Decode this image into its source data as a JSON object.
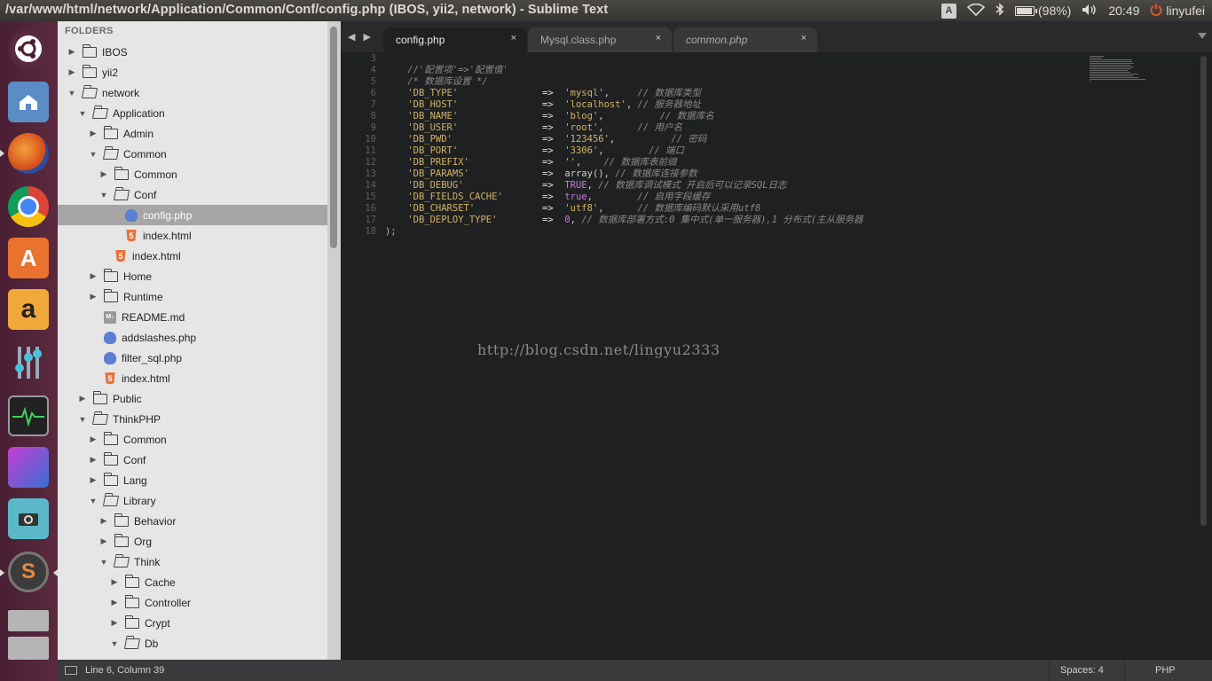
{
  "window": {
    "title": "/var/www/html/network/Application/Common/Conf/config.php (IBOS, yii2, network) - Sublime Text"
  },
  "top_panel": {
    "keyboard_indicator": "A",
    "battery_text": "(98%)",
    "battery_level": 0.98,
    "time": "20:49",
    "user": "linyufei"
  },
  "launcher": {
    "items": [
      "ubuntu-dash",
      "files",
      "firefox",
      "chrome",
      "software-center",
      "amazon",
      "mixer",
      "system-monitor",
      "workspaces",
      "screenshot",
      "sublime-text",
      "drives"
    ]
  },
  "sidebar": {
    "header": "FOLDERS",
    "rows": [
      {
        "label": "IBOS",
        "type": "folder",
        "open": false
      },
      {
        "label": "yii2",
        "type": "folder",
        "open": false
      },
      {
        "label": "network",
        "type": "folder",
        "open": true
      },
      {
        "label": "Application",
        "type": "folder",
        "open": true
      },
      {
        "label": "Admin",
        "type": "folder",
        "open": false
      },
      {
        "label": "Common",
        "type": "folder",
        "open": true
      },
      {
        "label": "Common",
        "type": "folder",
        "open": false
      },
      {
        "label": "Conf",
        "type": "folder",
        "open": true
      },
      {
        "label": "config.php",
        "type": "php",
        "selected": true
      },
      {
        "label": "index.html",
        "type": "html"
      },
      {
        "label": "index.html",
        "type": "html"
      },
      {
        "label": "Home",
        "type": "folder",
        "open": false
      },
      {
        "label": "Runtime",
        "type": "folder",
        "open": false
      },
      {
        "label": "README.md",
        "type": "md"
      },
      {
        "label": "addslashes.php",
        "type": "php"
      },
      {
        "label": "filter_sql.php",
        "type": "php"
      },
      {
        "label": "index.html",
        "type": "html"
      },
      {
        "label": "Public",
        "type": "folder",
        "open": false
      },
      {
        "label": "ThinkPHP",
        "type": "folder",
        "open": true
      },
      {
        "label": "Common",
        "type": "folder",
        "open": false
      },
      {
        "label": "Conf",
        "type": "folder",
        "open": false
      },
      {
        "label": "Lang",
        "type": "folder",
        "open": false
      },
      {
        "label": "Library",
        "type": "folder",
        "open": true
      },
      {
        "label": "Behavior",
        "type": "folder",
        "open": false
      },
      {
        "label": "Org",
        "type": "folder",
        "open": false
      },
      {
        "label": "Think",
        "type": "folder",
        "open": true
      },
      {
        "label": "Cache",
        "type": "folder",
        "open": false
      },
      {
        "label": "Controller",
        "type": "folder",
        "open": false
      },
      {
        "label": "Crypt",
        "type": "folder",
        "open": false
      },
      {
        "label": "Db",
        "type": "folder",
        "open": true
      }
    ]
  },
  "tabs": [
    {
      "label": "config.php",
      "close": "×",
      "active": true,
      "italic": false
    },
    {
      "label": "Mysql.class.php",
      "close": "×",
      "active": false,
      "italic": false
    },
    {
      "label": "common.php",
      "close": "×",
      "active": false,
      "italic": true
    }
  ],
  "editor": {
    "lines": [
      {
        "n": "3",
        "code": ""
      },
      {
        "n": "4",
        "code": "    //'配置项'=>'配置值'"
      },
      {
        "n": "5",
        "code": "    /* 数据库设置 */"
      },
      {
        "n": "6",
        "code": "    'DB_TYPE'               =>  'mysql',     // 数据库类型"
      },
      {
        "n": "7",
        "code": "    'DB_HOST'               =>  'localhost', // 服务器地址"
      },
      {
        "n": "8",
        "code": "    'DB_NAME'               =>  'blog',          // 数据库名"
      },
      {
        "n": "9",
        "code": "    'DB_USER'               =>  'root',      // 用户名"
      },
      {
        "n": "10",
        "code": "    'DB_PWD'                =>  '123456',          // 密码"
      },
      {
        "n": "11",
        "code": "    'DB_PORT'               =>  '3306',        // 端口"
      },
      {
        "n": "12",
        "code": "    'DB_PREFIX'             =>  '',    // 数据库表前缀"
      },
      {
        "n": "13",
        "code": "    'DB_PARAMS'             =>  array(), // 数据库连接参数"
      },
      {
        "n": "14",
        "code": "    'DB_DEBUG'              =>  TRUE, // 数据库调试模式 开启后可以记录SQL日志"
      },
      {
        "n": "15",
        "code": "    'DB_FIELDS_CACHE'       =>  true,        // 启用字段缓存"
      },
      {
        "n": "16",
        "code": "    'DB_CHARSET'            =>  'utf8',      // 数据库编码默认采用utf8"
      },
      {
        "n": "17",
        "code": "    'DB_DEPLOY_TYPE'        =>  0, // 数据库部署方式:0 集中式(单一服务器),1 分布式(主从服务器"
      },
      {
        "n": "18",
        "code": ");"
      }
    ],
    "watermark": "http://blog.csdn.net/lingyu2333"
  },
  "statusbar": {
    "position": "Line 6, Column 39",
    "spaces": "Spaces: 4",
    "syntax": "PHP"
  }
}
